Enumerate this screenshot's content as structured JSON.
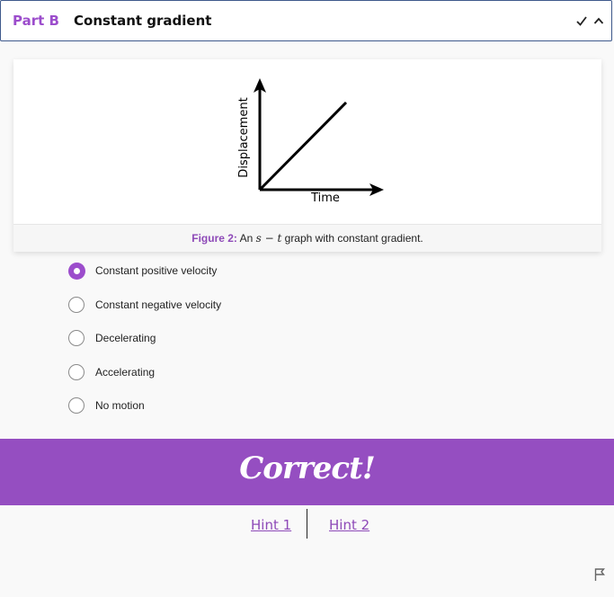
{
  "header": {
    "part_label": "Part B",
    "title": "Constant gradient",
    "icons": [
      "check-icon",
      "chevron-up-icon"
    ]
  },
  "figure": {
    "y_axis_label": "Displacement",
    "x_axis_label": "Time",
    "caption_prefix": "Figure 2:",
    "caption_pre_math": "An",
    "caption_math": "s − t",
    "caption_post_math": "graph with constant gradient."
  },
  "options": [
    {
      "label": "Constant positive velocity",
      "selected": true
    },
    {
      "label": "Constant negative velocity",
      "selected": false
    },
    {
      "label": "Decelerating",
      "selected": false
    },
    {
      "label": "Accelerating",
      "selected": false
    },
    {
      "label": "No motion",
      "selected": false
    }
  ],
  "feedback": {
    "text": "Correct!"
  },
  "hints": [
    "Hint 1",
    "Hint 2"
  ],
  "colors": {
    "accent": "#954ec1",
    "link": "#8e4ab8",
    "header_border": "#3f5a8c"
  },
  "footer": {
    "icon": "flag-icon"
  }
}
